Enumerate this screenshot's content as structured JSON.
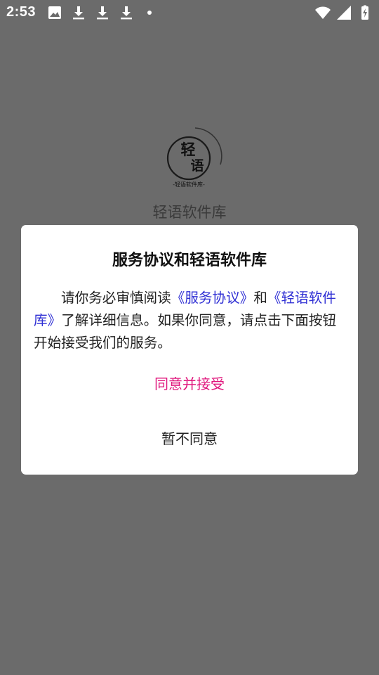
{
  "status_bar": {
    "time": "2:53",
    "left_icons": [
      "image-icon",
      "download-icon",
      "download-icon",
      "download-icon",
      "notification-dot"
    ],
    "right_icons": [
      "wifi-icon",
      "cell-signal-icon",
      "battery-charging-icon"
    ]
  },
  "splash": {
    "logo_text_large": "轻语",
    "logo_text_small": "-轻语软件库-",
    "app_name": "轻语软件库"
  },
  "dialog": {
    "title": "服务协议和轻语软件库",
    "body_prefix": "请你务必审慎阅读",
    "link_service": "《服务协议》",
    "body_and": "和",
    "link_app": "《轻语软件库》",
    "body_suffix": "了解详细信息。如果你同意，请点击下面按钮开始接受我们的服务。",
    "agree_label": "同意并接受",
    "decline_label": "暂不同意"
  },
  "colors": {
    "overlay": "#6b6b6b",
    "link": "#2f2fd4",
    "agree": "#e0177d"
  }
}
